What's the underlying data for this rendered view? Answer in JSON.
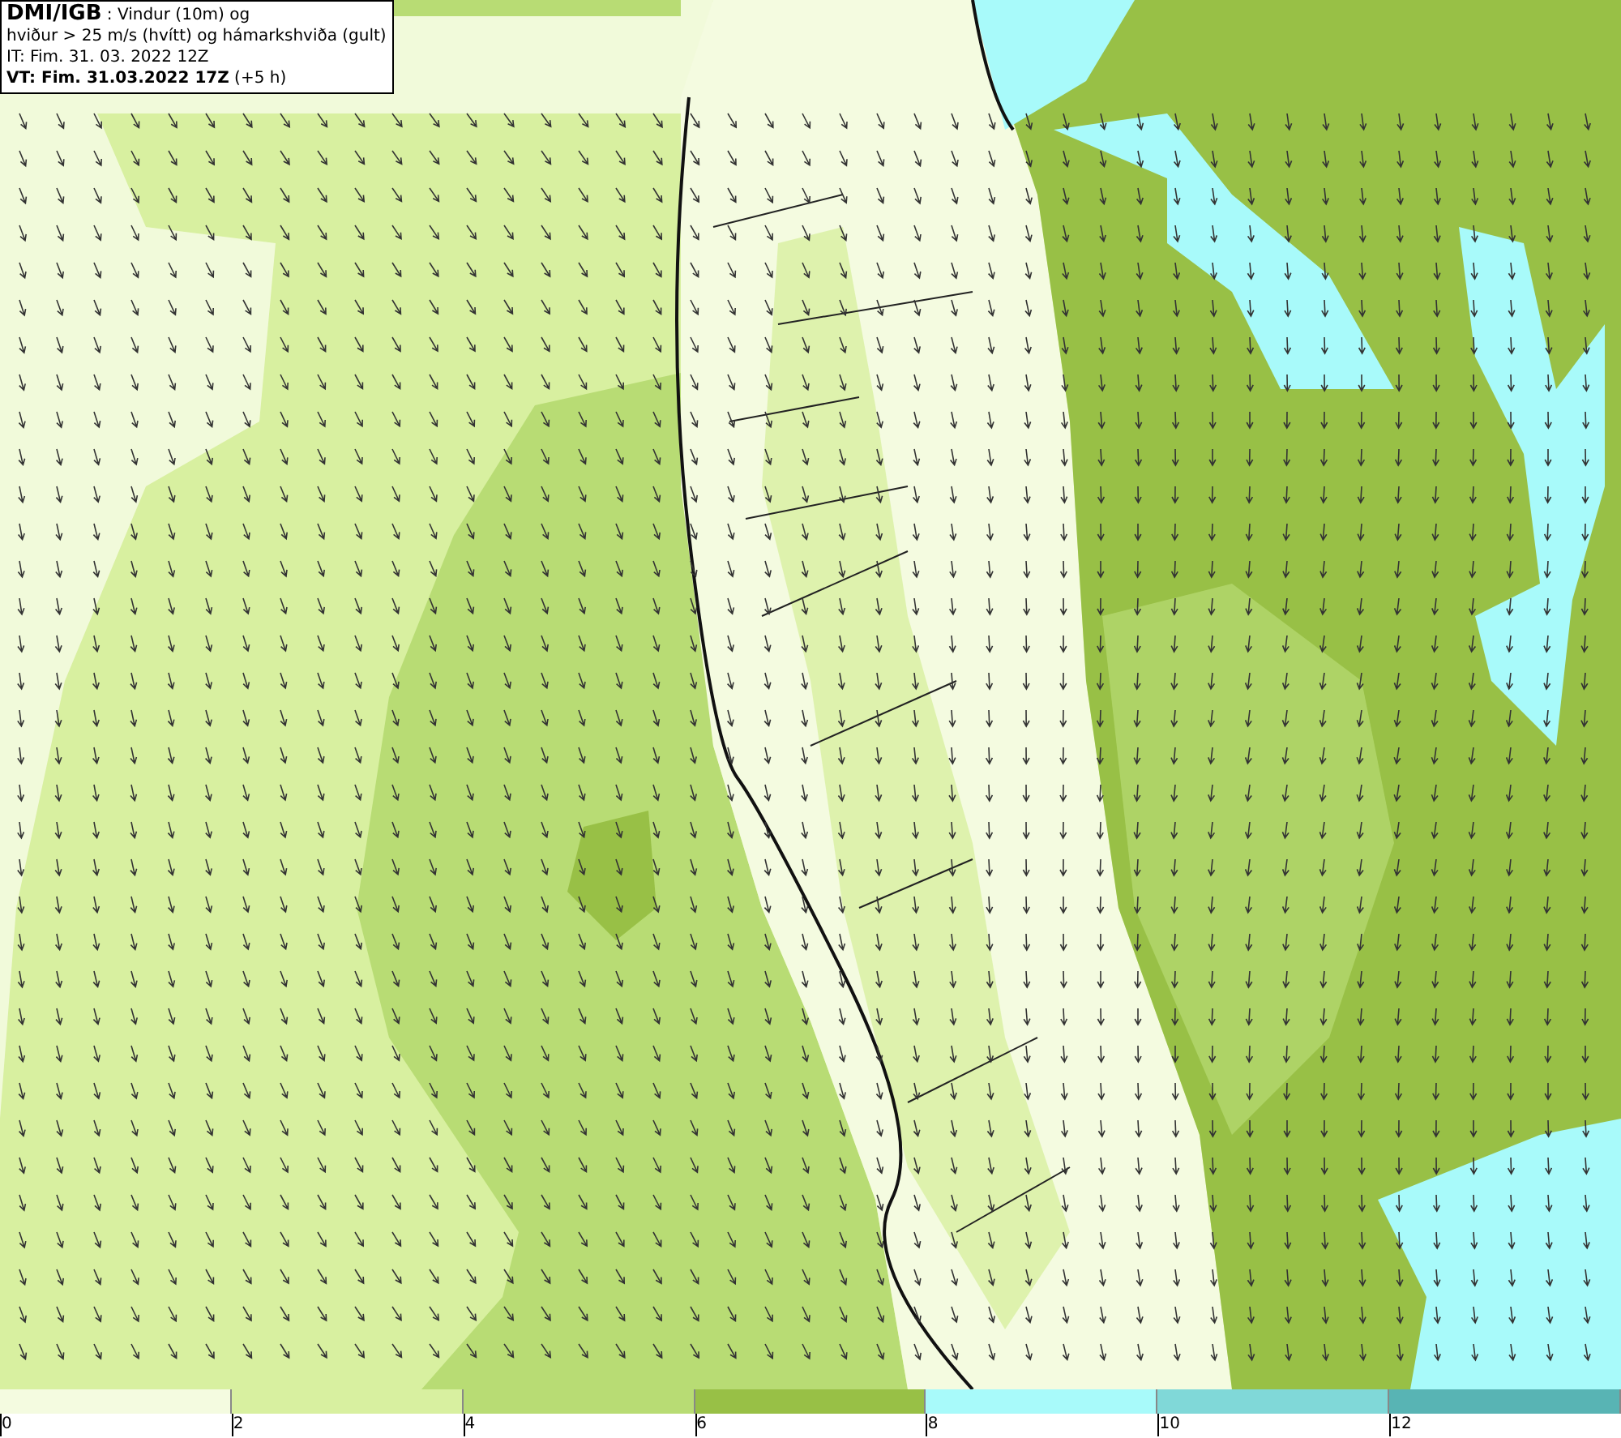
{
  "info_box": {
    "lines": [
      "**DMI/IGB** : Vindur (10m) og",
      "hviður > 25 m/s (hvítt) og hámarkshviða (gult)",
      "IT: Fim. 31. 03. 2022 12Z",
      "**VT: Fim. 31.03.2022 17Z** (+5 h)"
    ]
  },
  "legend": {
    "bins": [
      {
        "color": "#f4fbe0",
        "label": "0"
      },
      {
        "color": "#d8f0a0",
        "label": "2"
      },
      {
        "color": "#b8dc74",
        "label": "4"
      },
      {
        "color": "#98c046",
        "label": "6"
      },
      {
        "color": "#a8fafa",
        "label": "8"
      },
      {
        "color": "#80d8d8",
        "label": "10"
      },
      {
        "color": "#58b4b4",
        "label": "12"
      }
    ]
  }
}
